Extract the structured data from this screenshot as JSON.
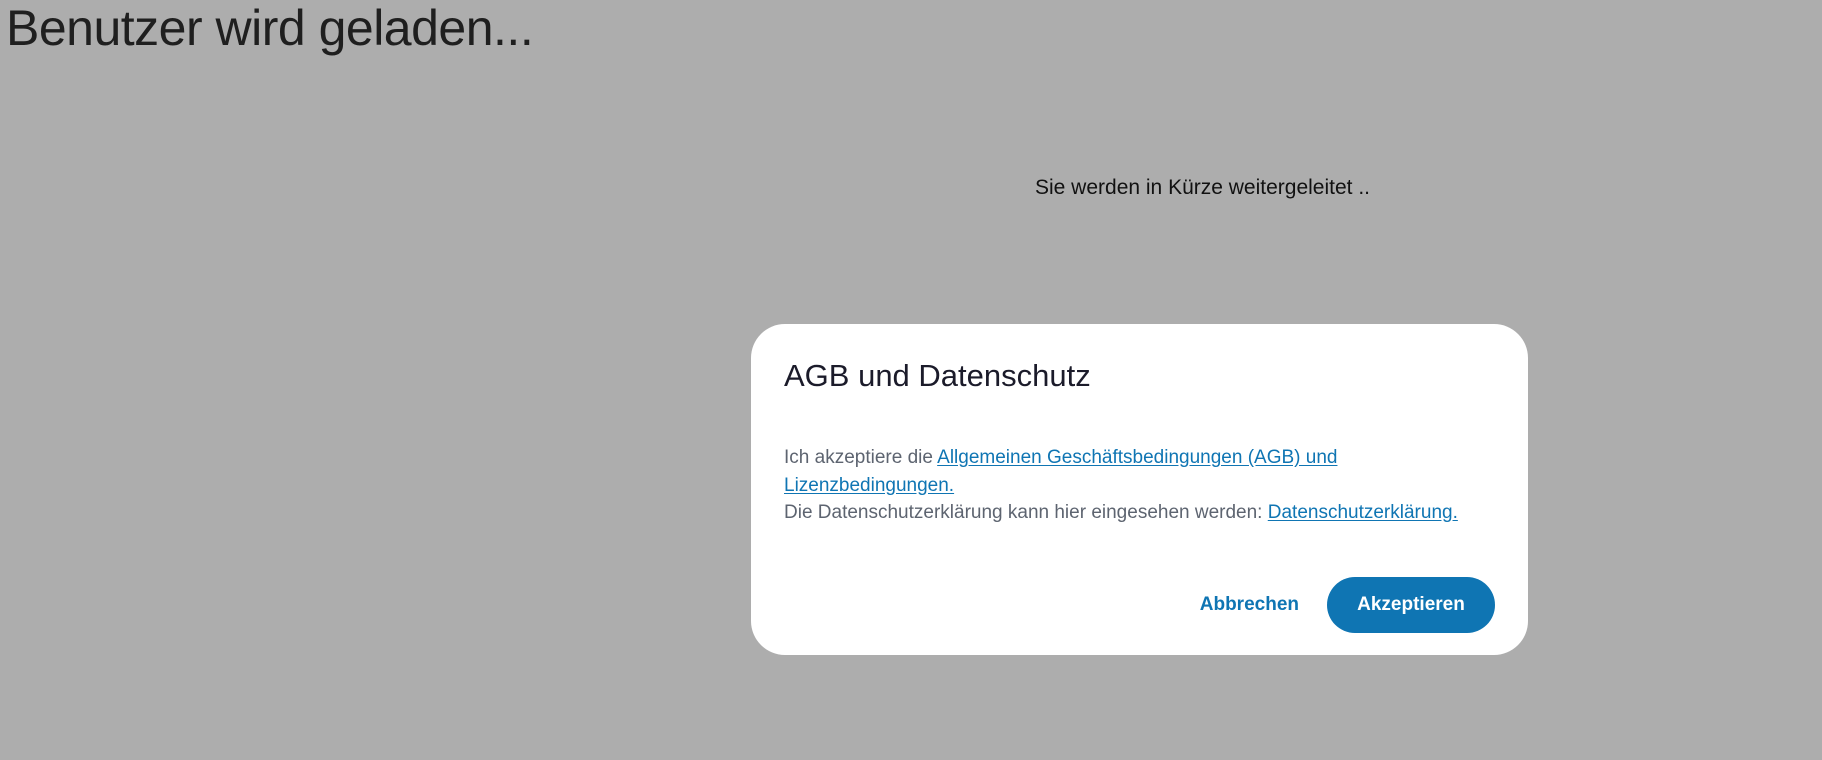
{
  "page": {
    "heading": "Benutzer wird geladen...",
    "redirect_message": "Sie werden in Kürze weitergeleitet .."
  },
  "dialog": {
    "title": "AGB und Datenschutz",
    "terms_prefix": "Ich akzeptiere die ",
    "terms_link": "Allgemeinen Geschäftsbedingungen (AGB) und Lizenzbedingungen.",
    "privacy_prefix": "Die Datenschutzerklärung kann hier eingesehen werden: ",
    "privacy_link": "Datenschutzerklärung.",
    "cancel_label": "Abbrechen",
    "accept_label": "Akzeptieren"
  },
  "colors": {
    "backdrop": "#adadad",
    "accent": "#0f75b3",
    "body_text": "#5d6470",
    "dialog_background": "#ffffff"
  }
}
